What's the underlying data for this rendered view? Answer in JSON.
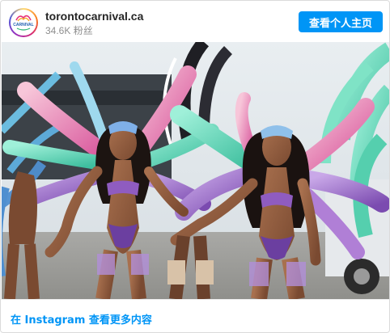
{
  "header": {
    "account_name": "torontocarnival.ca",
    "followers": "34.6K 粉丝",
    "view_profile_label": "查看个人主页",
    "avatar_logo_text": "CARNIVAL"
  },
  "photo": {
    "description_icon": "carnival-photo"
  },
  "footer": {
    "view_more_label": "在 Instagram 查看更多内容"
  },
  "colors": {
    "accent": "#0095f6",
    "text_primary": "#262626",
    "text_secondary": "#8e8e8e",
    "border": "#dbdbdb"
  }
}
